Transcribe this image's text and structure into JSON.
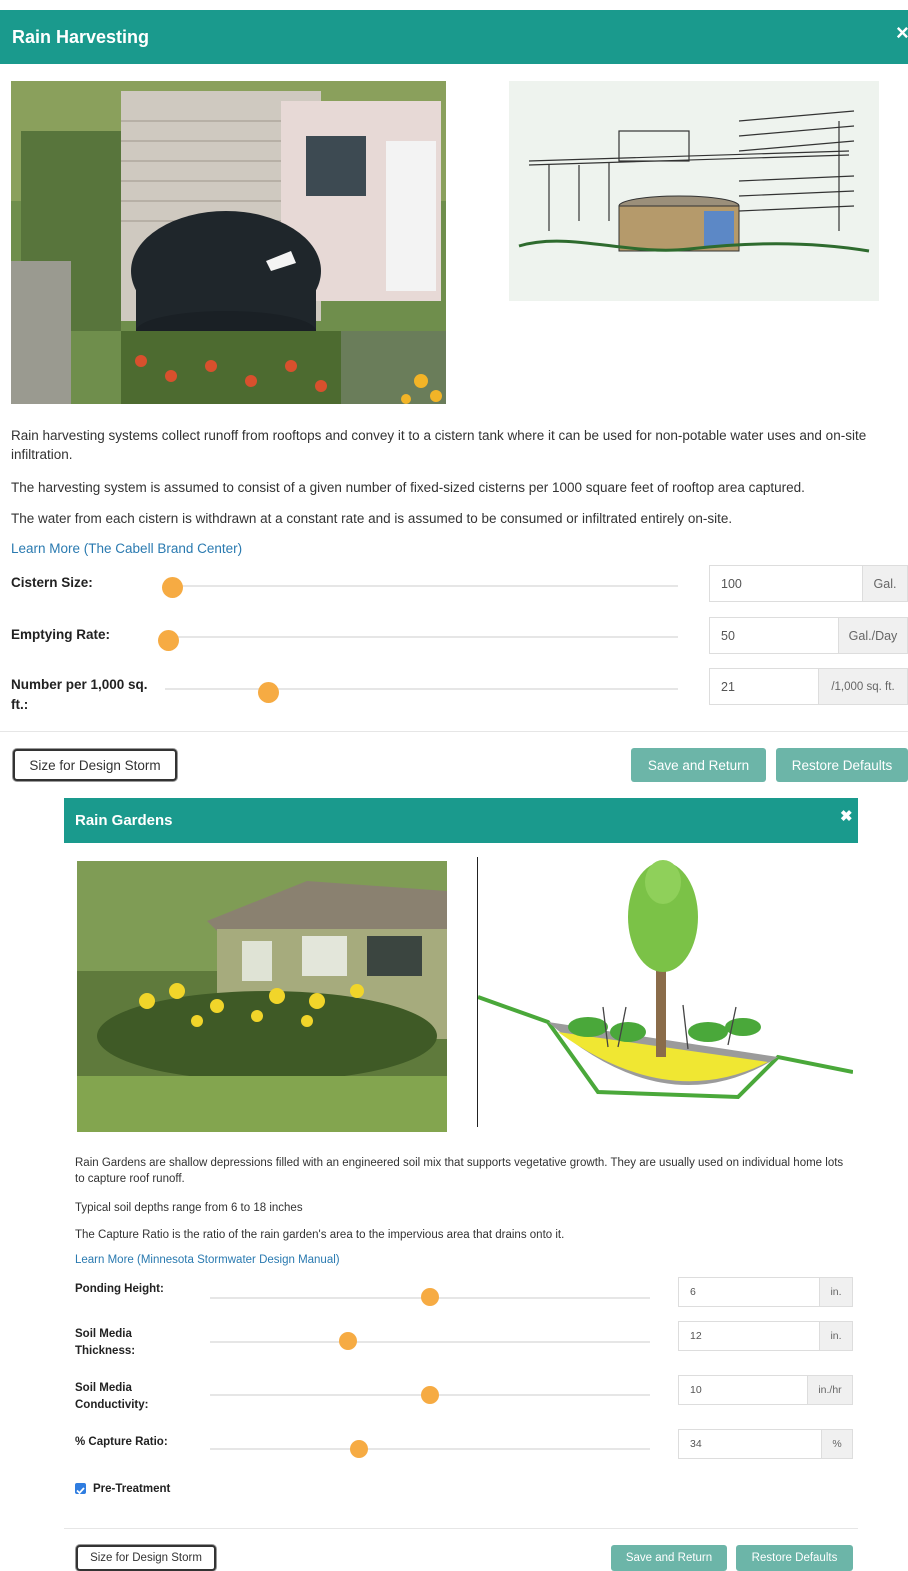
{
  "harvest": {
    "title": "Rain Harvesting",
    "close_icon": "×",
    "description": [
      "Rain harvesting systems collect runoff from rooftops and convey it to a cistern tank where it can be used for non-potable water uses and on-site infiltration.",
      "The harvesting system is assumed to consist of a given number of fixed-sized cisterns per 1000 square feet of rooftop area captured.",
      "The water from each cistern is withdrawn at a constant rate and is assumed to be consumed or infiltrated entirely on-site."
    ],
    "learn_more": "Learn More (The Cabell Brand Center)",
    "params": [
      {
        "label": "Cistern Size:",
        "value": "100",
        "unit": "Gal.",
        "slider_fraction": 0.01
      },
      {
        "label": "Emptying Rate:",
        "value": "50",
        "unit": "Gal./Day",
        "slider_fraction": 0.0
      },
      {
        "label": "Number per 1,000 sq. ft.:",
        "value": "21",
        "unit": "/1,000 sq. ft.",
        "slider_fraction": 0.2
      }
    ],
    "buttons": {
      "size_storm": "Size for Design Storm",
      "save": "Save and Return",
      "restore": "Restore Defaults"
    }
  },
  "garden": {
    "title": "Rain Gardens",
    "close_icon": "✖",
    "description": [
      "Rain Gardens are shallow depressions filled with an engineered soil mix that supports vegetative growth. They are usually used on individual home lots to capture roof runoff.",
      "Typical soil depths range from 6 to 18 inches",
      "The Capture Ratio is the ratio of the rain garden's area to the impervious area that drains onto it."
    ],
    "learn_more": "Learn More (Minnesota Stormwater Design Manual)",
    "params": [
      {
        "label": "Ponding Height:",
        "value": "6",
        "unit": "in.",
        "slider_fraction": 0.5
      },
      {
        "label": "Soil Media Thickness:",
        "value": "12",
        "unit": "in.",
        "slider_fraction": 0.3
      },
      {
        "label": "Soil Media Conductivity:",
        "value": "10",
        "unit": "in./hr",
        "slider_fraction": 0.5
      },
      {
        "label": "% Capture Ratio:",
        "value": "34",
        "unit": "%",
        "slider_fraction": 0.34
      }
    ],
    "pretreatment": {
      "label": "Pre-Treatment",
      "checked": true
    },
    "buttons": {
      "size_storm": "Size for Design Storm",
      "save": "Save and Return",
      "restore": "Restore Defaults"
    }
  },
  "colors": {
    "header": "#1a9a8d",
    "slider_thumb": "#f6ab43",
    "button_teal": "#6cb5a8",
    "link": "#2a7ab0"
  }
}
